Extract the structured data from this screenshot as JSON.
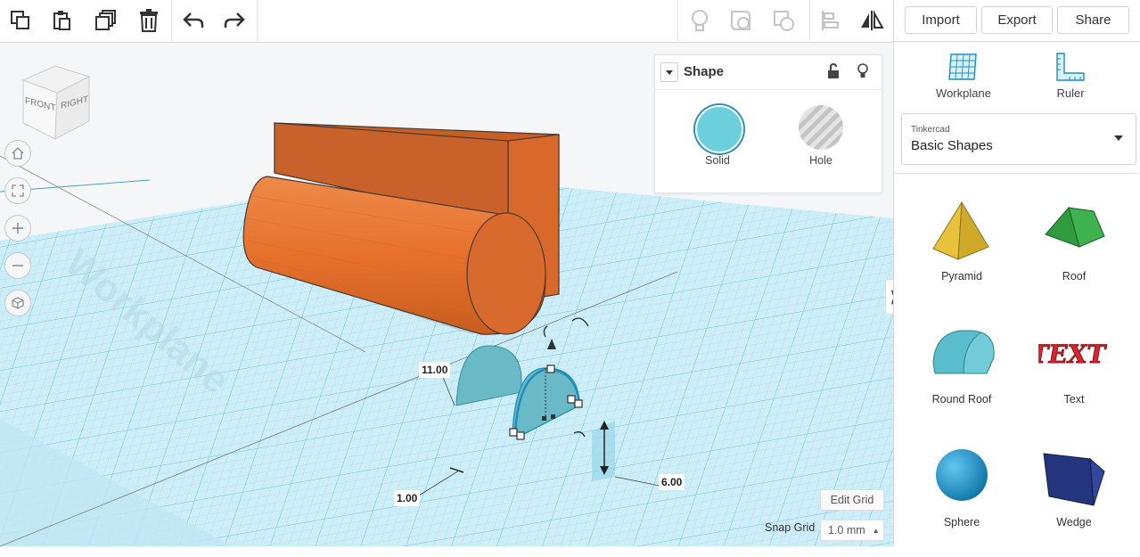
{
  "toolbar": {
    "icons": [
      "copy-icon",
      "paste-icon",
      "duplicate-icon",
      "delete-icon",
      "undo-icon",
      "redo-icon",
      "light-bulb-icon",
      "group-icon",
      "ungroup-icon",
      "align-icon",
      "mirror-icon"
    ]
  },
  "top_actions": {
    "import_label": "Import",
    "export_label": "Export",
    "share_label": "Share"
  },
  "view_cube": {
    "front_label": "FRONT",
    "right_label": "RIGHT"
  },
  "nav_icons": [
    "home-icon",
    "fit-view-icon",
    "zoom-in-icon",
    "zoom-out-icon",
    "perspective-icon"
  ],
  "workplane_text": "Workplane",
  "inspector": {
    "title": "Shape",
    "solid_label": "Solid",
    "hole_label": "Hole",
    "solid_color": "#6ccfdc"
  },
  "dimensions": {
    "height": "11.00",
    "width": "1.00",
    "depth": "6.00"
  },
  "grid": {
    "edit_label": "Edit Grid",
    "snap_label": "Snap Grid",
    "snap_value": "1.0 mm"
  },
  "sidebar": {
    "workplane_label": "Workplane",
    "ruler_label": "Ruler",
    "library_owner": "Tinkercad",
    "library_name": "Basic Shapes",
    "shapes": [
      {
        "label": "Pyramid",
        "color": "#e8c23c"
      },
      {
        "label": "Roof",
        "color": "#2e9c3f"
      },
      {
        "label": "Round Roof",
        "color": "#5bbccc"
      },
      {
        "label": "Text",
        "color": "#d7262f"
      },
      {
        "label": "Sphere",
        "color": "#1c9ad6"
      },
      {
        "label": "Wedge",
        "color": "#24357e"
      }
    ]
  },
  "colors": {
    "accent": "#2a8fbd",
    "object_orange": "#e6712c",
    "grid_line": "#8fd2e8"
  }
}
